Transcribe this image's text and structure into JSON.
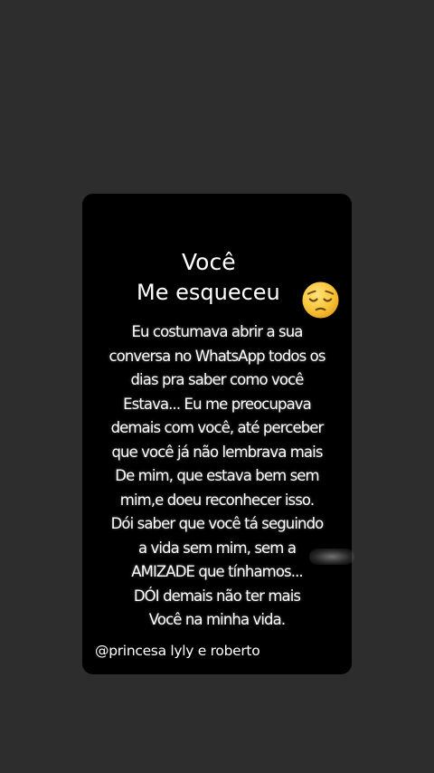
{
  "post": {
    "title_line_1": "Você",
    "title_line_2": "Me esqueceu",
    "title_emoji": "pensive-face",
    "lines": [
      "Eu costumava abrir a sua",
      "conversa no WhatsApp todos os",
      "dias pra saber como você",
      "Estava... Eu me preocupava",
      "demais com você, até perceber",
      "que você já não lembrava mais",
      "De mim, que estava bem sem",
      "mim,e doeu reconhecer isso.",
      "Dói saber que você tá seguindo",
      "a vida sem mim, sem a",
      "AMIZADE que tínhamos...",
      "DÓI demais não ter mais",
      "Você na minha vida."
    ],
    "credit": "@princesa lyly e roberto"
  },
  "colors": {
    "page_background": "#2d2d2d",
    "card_background": "#000000",
    "text": "#ffffff",
    "emoji_face": "#f6c23a"
  }
}
